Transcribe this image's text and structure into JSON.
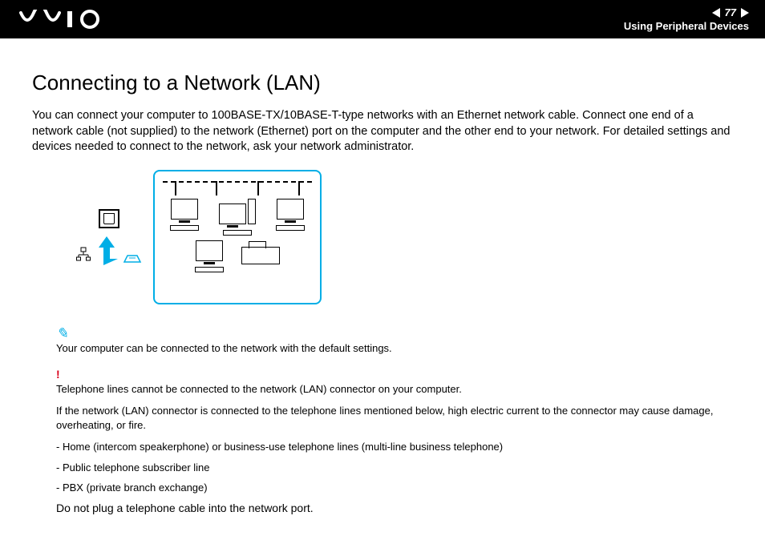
{
  "header": {
    "page_number": "77",
    "section": "Using Peripheral Devices",
    "logo_alt": "VAIO"
  },
  "title": "Connecting to a Network (LAN)",
  "intro": "You can connect your computer to 100BASE-TX/10BASE-T-type networks with an Ethernet network cable. Connect one end of a network cable (not supplied) to the network (Ethernet) port on the computer and the other end to your network. For detailed settings and devices needed to connect to the network, ask your network administrator.",
  "note": "Your computer can be connected to the network with the default settings.",
  "warning_lines": [
    "Telephone lines cannot be connected to the network (LAN) connector on your computer.",
    "If the network (LAN) connector is connected to the telephone lines mentioned below, high electric current to the connector may cause damage, overheating, or fire."
  ],
  "bullets": [
    "- Home (intercom speakerphone) or business-use telephone lines (multi-line business telephone)",
    "- Public telephone subscriber line",
    "- PBX (private branch exchange)"
  ],
  "final": "Do not plug a telephone cable into the network port."
}
